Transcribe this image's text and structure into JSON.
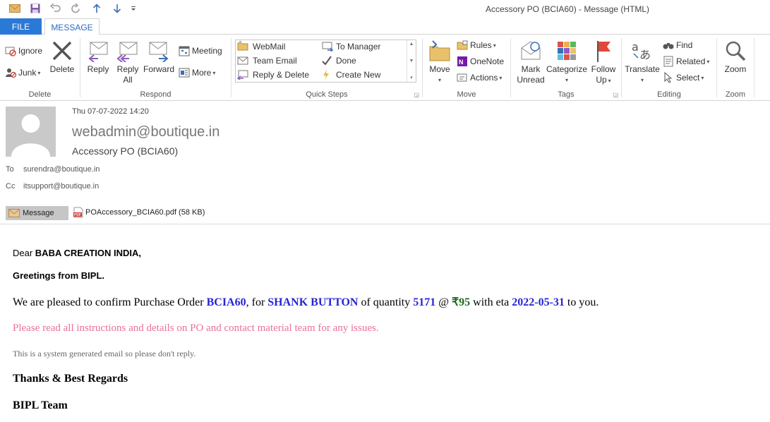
{
  "window": {
    "title": "Accessory PO (BCIA60) - Message (HTML)"
  },
  "tabs": {
    "file": "FILE",
    "message": "MESSAGE"
  },
  "ribbon": {
    "delete_group": {
      "ignore": "Ignore",
      "junk": "Junk",
      "delete": "Delete",
      "label": "Delete"
    },
    "respond_group": {
      "reply": "Reply",
      "reply_all_1": "Reply",
      "reply_all_2": "All",
      "forward": "Forward",
      "meeting": "Meeting",
      "more": "More",
      "label": "Respond"
    },
    "quick_steps": {
      "webmail": "WebMail",
      "team_email": "Team Email",
      "reply_delete": "Reply & Delete",
      "to_manager": "To Manager",
      "done": "Done",
      "create_new": "Create New",
      "label": "Quick Steps"
    },
    "move_group": {
      "move": "Move",
      "rules": "Rules",
      "onenote": "OneNote",
      "actions": "Actions",
      "label": "Move"
    },
    "tags_group": {
      "mark_unread_1": "Mark",
      "mark_unread_2": "Unread",
      "categorize": "Categorize",
      "follow_up_1": "Follow",
      "follow_up_2": "Up",
      "label": "Tags"
    },
    "editing_group": {
      "translate": "Translate",
      "find": "Find",
      "related": "Related",
      "select": "Select",
      "label": "Editing"
    },
    "zoom_group": {
      "zoom": "Zoom",
      "label": "Zoom"
    }
  },
  "header": {
    "date": "Thu 07-07-2022 14:20",
    "sender": "webadmin@boutique.in",
    "subject": "Accessory PO (BCIA60)",
    "to_label": "To",
    "to_value": "surendra@boutique.in",
    "cc_label": "Cc",
    "cc_value": "itsupport@boutique.in",
    "message_tab": "Message",
    "attachment_name": "POAccessory_BCIA60.pdf (58 KB)"
  },
  "body": {
    "dear": "Dear ",
    "dear_name": "BABA CREATION INDIA,",
    "greeting": "Greetings from BIPL.",
    "confirm_1": "We are pleased to confirm Purchase Order ",
    "po_number": "BCIA60",
    "confirm_2": ", for ",
    "item": "SHANK BUTTON",
    "confirm_3": " of quantity ",
    "quantity": "5171",
    "confirm_4": " @ ",
    "price": "₹95",
    "confirm_5": " with eta ",
    "eta": "2022-05-31",
    "confirm_6": " to you.",
    "instructions": "Please read all instructions and details on PO and contact material team for any issues.",
    "system_note": "This is a system generated email so please don't reply.",
    "thanks": "Thanks & Best Regards",
    "team": "BIPL Team"
  },
  "colors": {
    "accent": "#2b79d6",
    "highlight_blue": "#2525d6",
    "price_green": "#1e6a1e",
    "warning_pink": "#e8709a"
  }
}
